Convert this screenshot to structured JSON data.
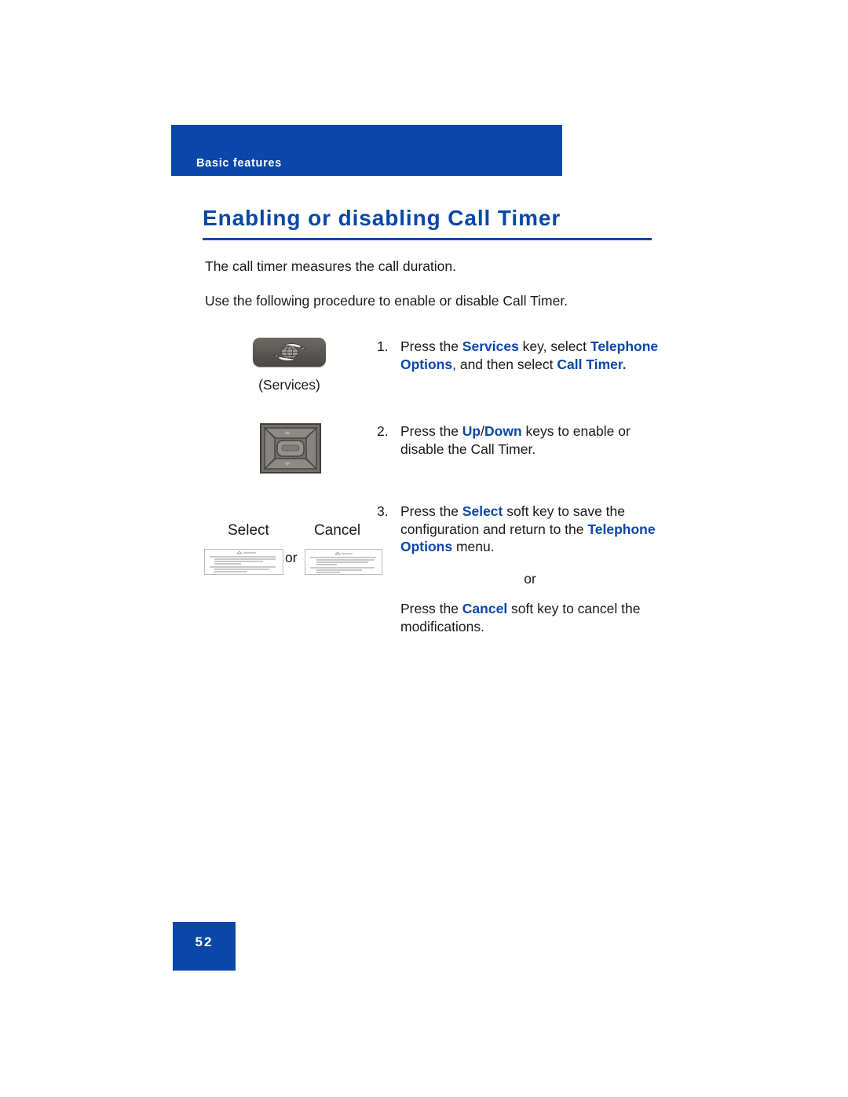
{
  "document": {
    "running_header": "Basic features",
    "section_title": "Enabling or disabling Call Timer",
    "page_number": "52",
    "accent_color": "#0a47a8",
    "text_color": "#1a1a1a"
  },
  "intro": {
    "paragraph_1": "The call timer measures the call duration.",
    "paragraph_2": "Use the following procedure to enable or disable Call Timer."
  },
  "steps": [
    {
      "number": "1.",
      "key_icon": "services-globe-arrows-icon",
      "key_caption": "(Services)",
      "text_part_1": "Press the ",
      "bold_1": "Services",
      "text_part_2": " key, select ",
      "bold_2": "Telephone Options",
      "text_part_3": ", and then select ",
      "bold_3": "Call Timer."
    },
    {
      "number": "2.",
      "key_icon": "navigation-updown-pad-icon",
      "text_part_1": "Press the ",
      "bold_1": "Up",
      "separator": "/",
      "bold_2": "Down",
      "text_part_2": " keys to enable or disable the Call Timer."
    },
    {
      "number": "3.",
      "text_part_1": "Press the ",
      "bold_1": "Select",
      "text_part_2": " soft key to save the configuration and return to the ",
      "bold_2": "Telephone Options",
      "text_part_3": " menu.",
      "or_label": "or",
      "text_part_4": "Press the ",
      "bold_3": "Cancel",
      "text_part_5": " soft key to cancel the modifications."
    }
  ],
  "softkeys": {
    "select_label": "Select",
    "cancel_label": "Cancel",
    "or_label": "or",
    "select_thumbnail": "select-soft-key-thumbnail",
    "cancel_thumbnail": "cancel-soft-key-thumbnail"
  }
}
